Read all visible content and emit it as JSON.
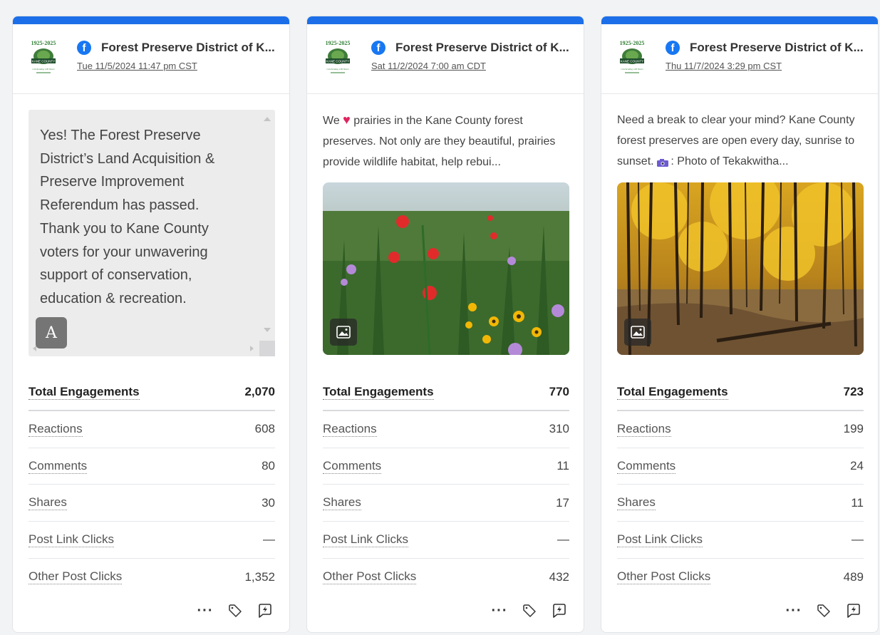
{
  "posts": [
    {
      "page_name": "Forest Preserve District of K...",
      "date": "Tue 11/5/2024 11:47 pm CST",
      "body_text": "Yes! The Forest Preserve District’s Land Acquisition & Preserve Improvement Referendum has passed. Thank you to Kane County voters for your unwavering support of conservation, education & recreation.",
      "ai_badge": "A",
      "metrics": {
        "total_label": "Total Engagements",
        "total": "2,070",
        "reactions_label": "Reactions",
        "reactions": "608",
        "comments_label": "Comments",
        "comments": "80",
        "shares_label": "Shares",
        "shares": "30",
        "link_clicks_label": "Post Link Clicks",
        "link_clicks": "—",
        "other_clicks_label": "Other Post Clicks",
        "other_clicks": "1,352"
      }
    },
    {
      "page_name": "Forest Preserve District of K...",
      "date": "Sat 11/2/2024 7:00 am CDT",
      "caption_pre": "We",
      "caption_post": " prairies in the Kane County forest preserves. Not only are they beautiful, prairies provide wildlife habitat, help rebui...",
      "photo_icon": "image-icon",
      "metrics": {
        "total_label": "Total Engagements",
        "total": "770",
        "reactions_label": "Reactions",
        "reactions": "310",
        "comments_label": "Comments",
        "comments": "11",
        "shares_label": "Shares",
        "shares": "17",
        "link_clicks_label": "Post Link Clicks",
        "link_clicks": "—",
        "other_clicks_label": "Other Post Clicks",
        "other_clicks": "432"
      }
    },
    {
      "page_name": "Forest Preserve District of K...",
      "date": "Thu 11/7/2024 3:29 pm CST",
      "caption_pre": "Need a break to clear your mind? Kane County forest preserves are open every day, sunrise to sunset.",
      "caption_post": ": Photo of Tekakwitha...",
      "photo_icon": "image-icon",
      "metrics": {
        "total_label": "Total Engagements",
        "total": "723",
        "reactions_label": "Reactions",
        "reactions": "199",
        "comments_label": "Comments",
        "comments": "24",
        "shares_label": "Shares",
        "shares": "11",
        "link_clicks_label": "Post Link Clicks",
        "link_clicks": "—",
        "other_clicks_label": "Other Post Clicks",
        "other_clicks": "489"
      }
    }
  ],
  "logo_text": {
    "years": "1925-2025",
    "banner": "KANE COUNTY",
    "tagline": "Celebrating 100 Years"
  },
  "actions": {
    "more": "more-icon",
    "tag": "tag-icon",
    "boost": "boost-icon"
  },
  "colors": {
    "accent": "#1c6fe8",
    "facebook": "#1877f2",
    "heart": "#e0245e"
  }
}
